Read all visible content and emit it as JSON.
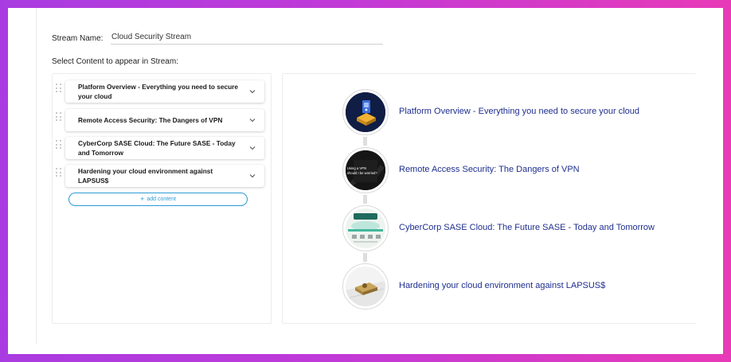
{
  "form": {
    "stream_name_label": "Stream Name:",
    "stream_name_value": "Cloud Security Stream",
    "select_content_label": "Select Content to appear in Stream:"
  },
  "content_list": {
    "items": [
      {
        "title": "Platform Overview - Everything you need to secure your cloud"
      },
      {
        "title": "Remote Access Security: The Dangers of VPN"
      },
      {
        "title": "CyberCorp SASE Cloud: The Future SASE - Today and Tomorrow"
      },
      {
        "title": "Hardening your cloud environment against LAPSUS$"
      }
    ],
    "add_content_label": "add content"
  },
  "preview": {
    "items": [
      {
        "title": "Platform Overview - Everything you need to secure your cloud"
      },
      {
        "title": "Remote Access Security: The Dangers of VPN"
      },
      {
        "title": "CyberCorp SASE Cloud: The Future SASE - Today and Tomorrow"
      },
      {
        "title": "Hardening your cloud environment against LAPSUS$"
      }
    ]
  },
  "thumbnails": {
    "vpn_text_line1": "Using a VPN",
    "vpn_text_line2": "should I be worried?"
  },
  "colors": {
    "link_title": "#1f2f8f",
    "accent": "#2c9bd6"
  }
}
